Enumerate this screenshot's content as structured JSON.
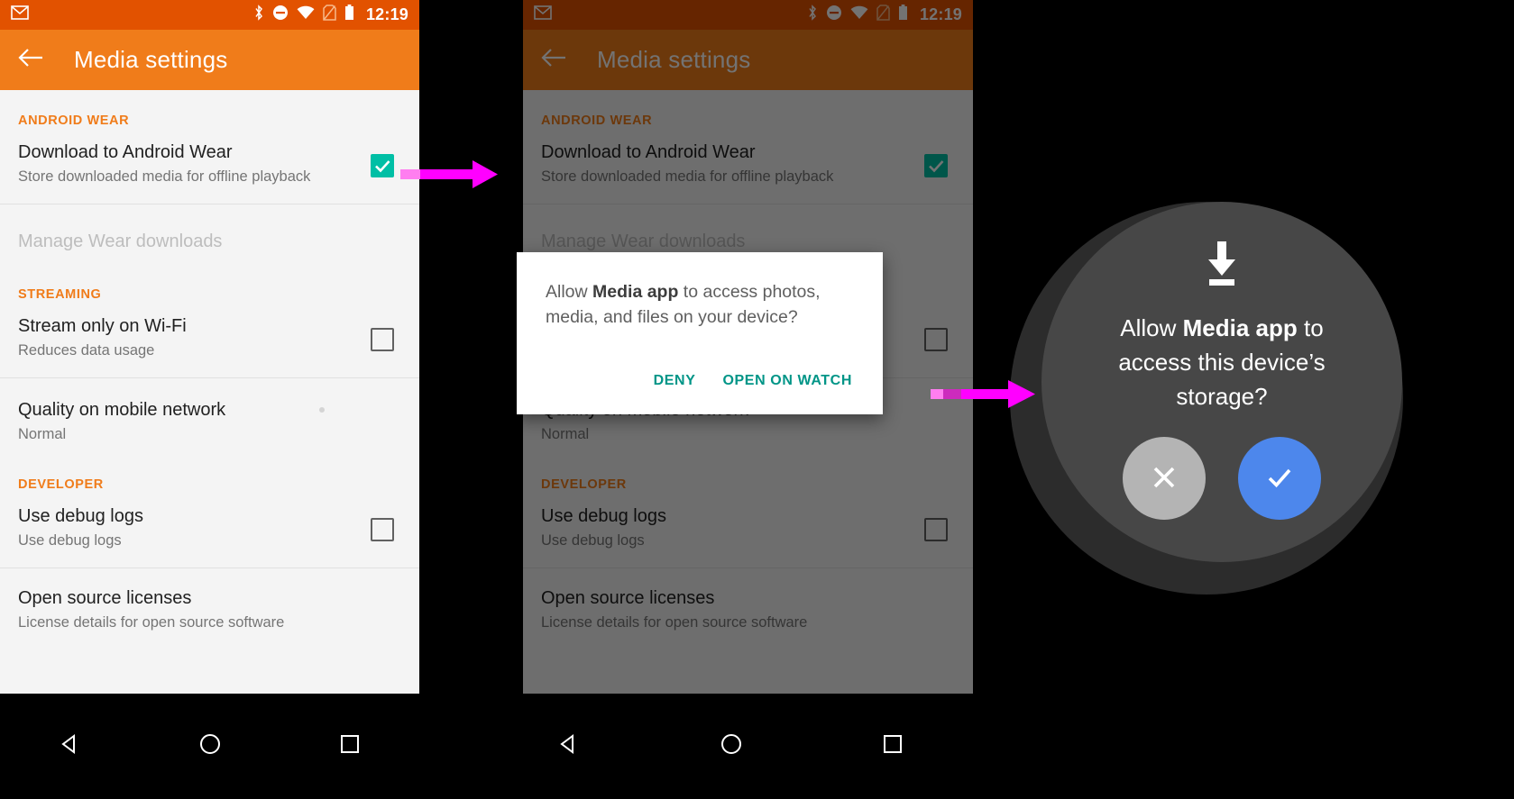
{
  "status_bar": {
    "clock": "12:19",
    "icons": [
      "gmail-icon",
      "bluetooth-icon",
      "do-not-disturb-icon",
      "wifi-icon",
      "no-sim-icon",
      "battery-icon"
    ]
  },
  "app_bar": {
    "back_label": "back-arrow",
    "title": "Media settings"
  },
  "settings": {
    "sections": [
      {
        "header": "ANDROID WEAR",
        "rows": [
          {
            "title": "Download to Android Wear",
            "sub": "Store downloaded media for offline playback",
            "checkbox": "checked",
            "disabled": false
          },
          {
            "title": "Manage Wear downloads",
            "sub": "",
            "checkbox": "none",
            "disabled": true
          }
        ]
      },
      {
        "header": "STREAMING",
        "rows": [
          {
            "title": "Stream only on Wi-Fi",
            "sub": "Reduces data usage",
            "checkbox": "unchecked",
            "disabled": false
          },
          {
            "title": "Quality on mobile network",
            "sub": "Normal",
            "checkbox": "none",
            "disabled": false
          }
        ]
      },
      {
        "header": "DEVELOPER",
        "rows": [
          {
            "title": "Use debug logs",
            "sub": "Use debug logs",
            "checkbox": "unchecked",
            "disabled": false
          },
          {
            "title": "Open source licenses",
            "sub": "License details for open source software",
            "checkbox": "none",
            "disabled": false
          }
        ]
      }
    ]
  },
  "nav_bar": {
    "back": "back-triangle-icon",
    "home": "home-circle-icon",
    "recents": "recents-square-icon"
  },
  "dialog": {
    "message_prefix": "Allow ",
    "message_app": "Media app",
    "message_suffix": " to access photos, media, and files on your device?",
    "deny_label": "DENY",
    "open_label": "OPEN ON WATCH"
  },
  "watch": {
    "icon": "download-to-storage-icon",
    "message_prefix": "Allow ",
    "message_app": "Media app",
    "message_suffix": "  to access this device’s storage?",
    "deny_label": "close-x-icon",
    "allow_label": "check-icon"
  },
  "colors": {
    "status_bar": "#e25200",
    "app_bar": "#f07c1a",
    "section_header": "#f07c1a",
    "checkbox_checked": "#00bfa5",
    "dialog_action": "#009587",
    "watch_allow": "#4d87ec",
    "watch_deny": "#b4b4b4",
    "arrow": "#ff00ff"
  }
}
